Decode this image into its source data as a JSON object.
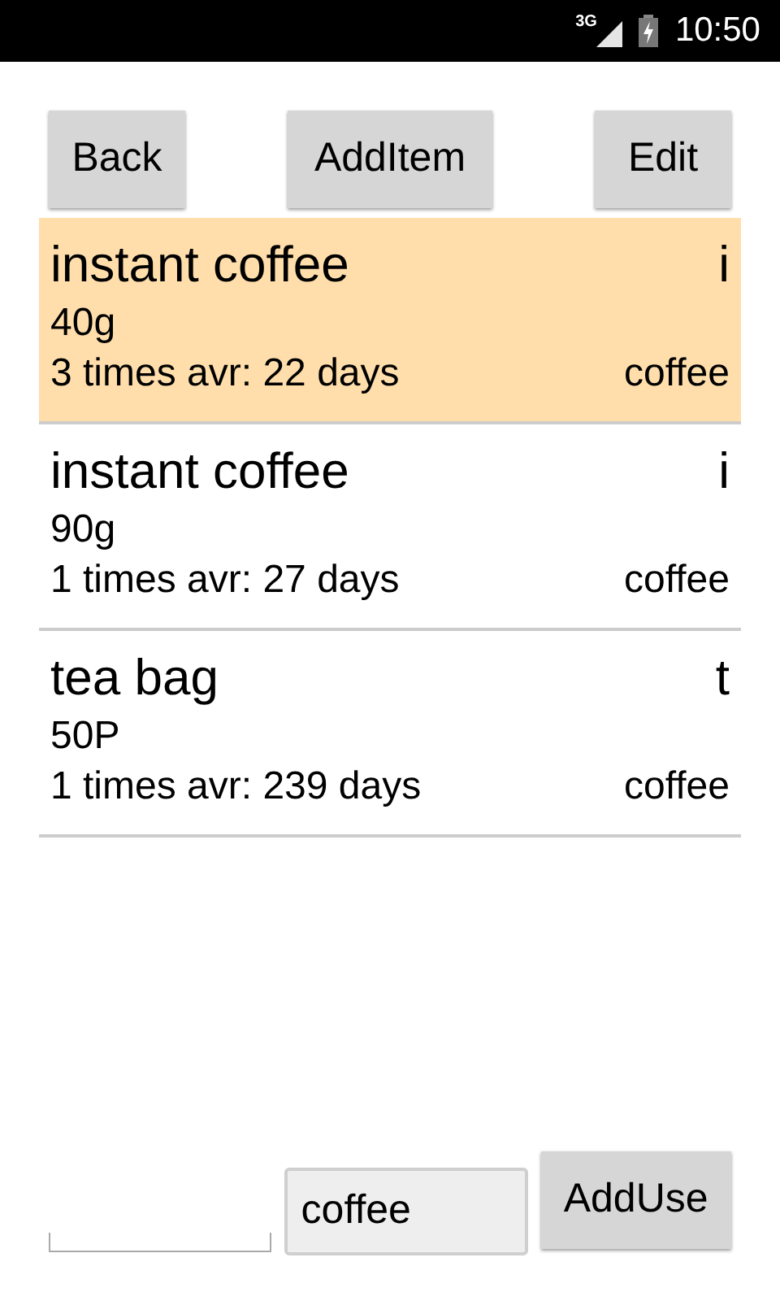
{
  "status_bar": {
    "network": "3G",
    "time": "10:50"
  },
  "buttons": [
    {
      "label": "Back"
    },
    {
      "label": "AddItem"
    },
    {
      "label": "Edit"
    }
  ],
  "items": [
    {
      "name": "instant coffee",
      "initial": "i",
      "size": "40g",
      "usage": "3 times avr: 22 days",
      "category": "coffee",
      "selected": true
    },
    {
      "name": "instant coffee",
      "initial": "i",
      "size": "90g",
      "usage": "1 times avr: 27 days",
      "category": "coffee",
      "selected": false
    },
    {
      "name": "tea bag",
      "initial": "t",
      "size": "50P",
      "usage": "1 times avr: 239 days",
      "category": "coffee",
      "selected": false
    }
  ],
  "bottom": {
    "category_field": {
      "value": "coffee"
    },
    "add_button": "AddUse"
  }
}
